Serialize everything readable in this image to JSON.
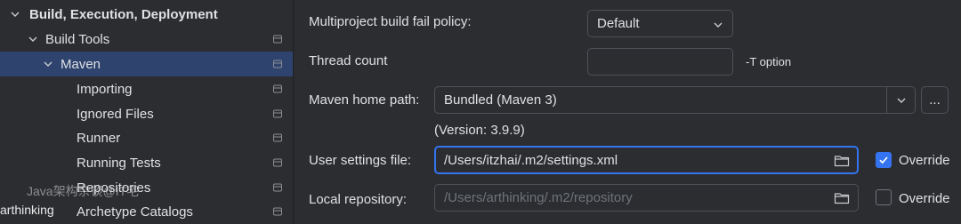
{
  "tree": {
    "items": [
      {
        "label": "Build, Execution, Deployment",
        "expanded": true,
        "bold": true
      },
      {
        "label": "Build Tools",
        "expanded": true
      },
      {
        "label": "Maven",
        "expanded": true,
        "selected": true
      },
      {
        "label": "Importing"
      },
      {
        "label": "Ignored Files"
      },
      {
        "label": "Runner"
      },
      {
        "label": "Running Tests"
      },
      {
        "label": "Repositories"
      },
      {
        "label": "Archetype Catalogs"
      }
    ]
  },
  "form": {
    "fail_policy": {
      "label": "Multiproject build fail policy:",
      "value": "Default"
    },
    "thread_count": {
      "label": "Thread count",
      "value": "",
      "hint": "-T option"
    },
    "maven_home": {
      "label": "Maven home path:",
      "value": "Bundled (Maven 3)",
      "browse_label": "...",
      "version": "(Version: 3.9.9)"
    },
    "user_settings": {
      "label": "User settings file:",
      "value": "/Users/itzhai/.m2/settings.xml",
      "override_label": "Override",
      "override_checked": true
    },
    "local_repo": {
      "label": "Local repository:",
      "placeholder": "/Users/arthinking/.m2/repository",
      "override_label": "Override",
      "override_checked": false
    }
  },
  "watermark": {
    "line1": "Java架构杂谈@IT宅",
    "line2": "arthinking"
  },
  "colors": {
    "background": "#2b2d30",
    "selection": "#2e436e",
    "accent": "#3574f0",
    "text": "#dfe1e5",
    "disabled_text": "#6f737a"
  }
}
